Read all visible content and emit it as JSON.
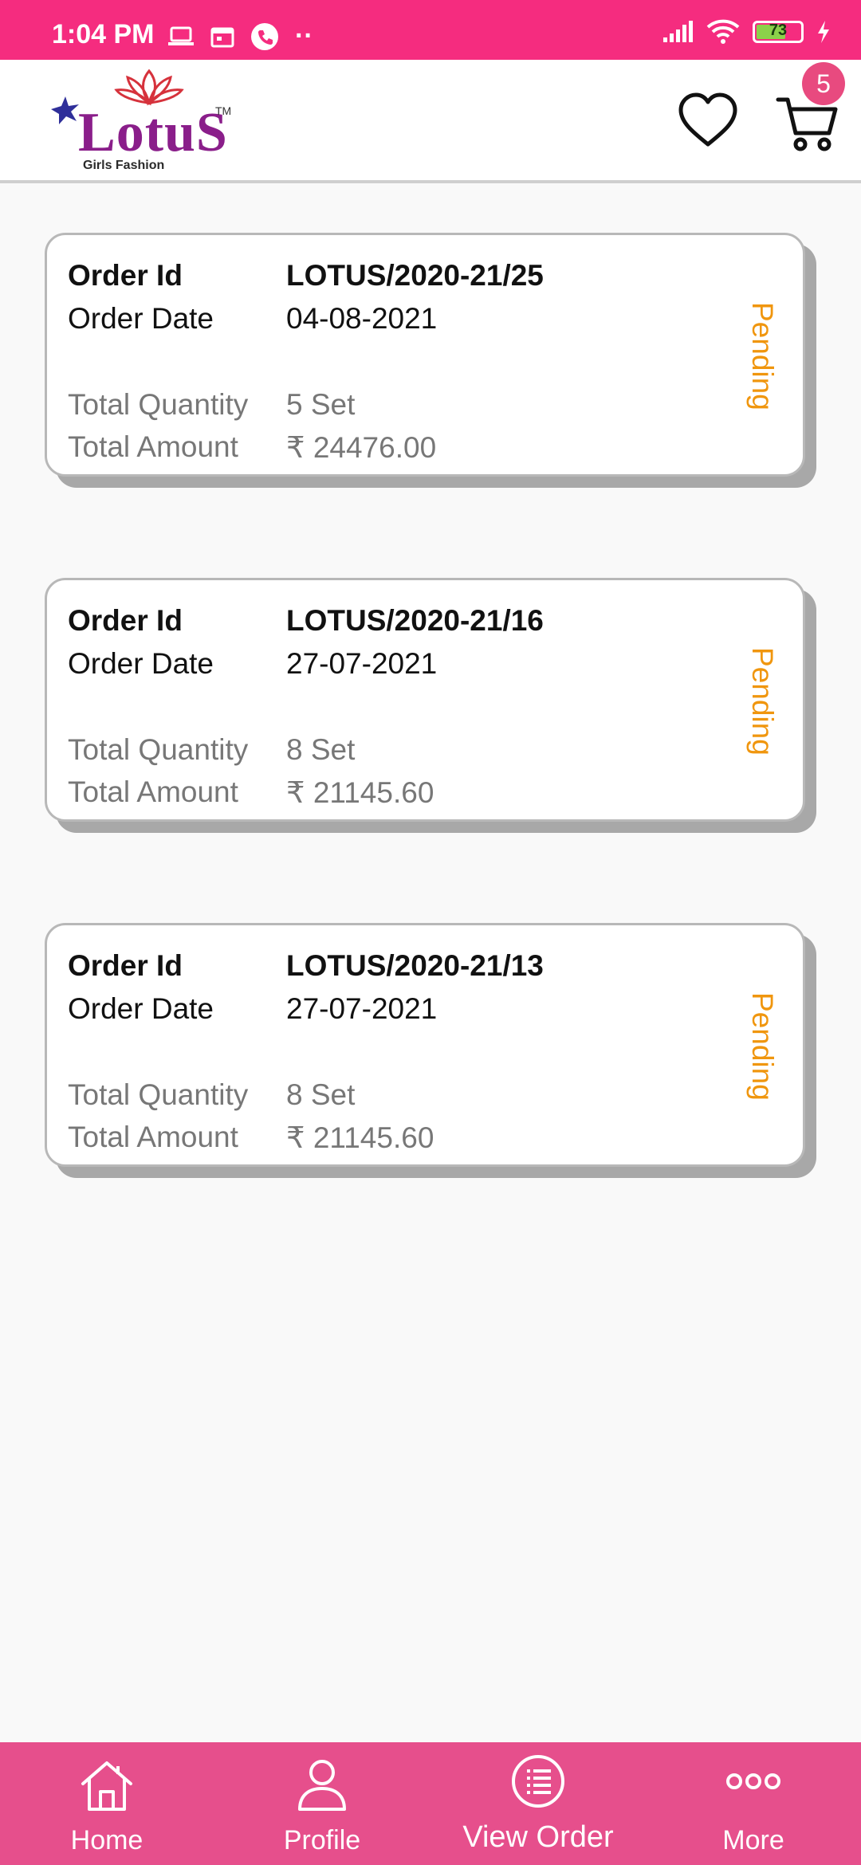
{
  "status_bar": {
    "time": "1:04 PM",
    "battery": "73",
    "dots": "··"
  },
  "header": {
    "logo_text": "LotuS",
    "logo_sub": "Girls Fashion",
    "logo_tm": "TM",
    "cart_count": "5"
  },
  "labels": {
    "order_id": "Order Id",
    "order_date": "Order Date",
    "total_quantity": "Total Quantity",
    "total_amount": "Total Amount"
  },
  "orders": [
    {
      "order_id": "LOTUS/2020-21/25",
      "order_date": "04-08-2021",
      "quantity": "5  Set",
      "amount": "₹  24476.00",
      "status": "Pending"
    },
    {
      "order_id": "LOTUS/2020-21/16",
      "order_date": "27-07-2021",
      "quantity": "8  Set",
      "amount": "₹  21145.60",
      "status": "Pending"
    },
    {
      "order_id": "LOTUS/2020-21/13",
      "order_date": "27-07-2021",
      "quantity": "8  Set",
      "amount": "₹  21145.60",
      "status": "Pending"
    }
  ],
  "bottom_nav": {
    "items": [
      {
        "label": "Home",
        "icon": "home-icon"
      },
      {
        "label": "Profile",
        "icon": "person-icon"
      },
      {
        "label": "View Order",
        "icon": "list-icon",
        "active": true
      },
      {
        "label": "More",
        "icon": "more-dots-icon"
      }
    ]
  },
  "colors": {
    "status_bar": "#f52c7f",
    "bottom_nav": "#e64f8c",
    "status_pending": "#f0960e",
    "logo": "#8a1e8a"
  }
}
